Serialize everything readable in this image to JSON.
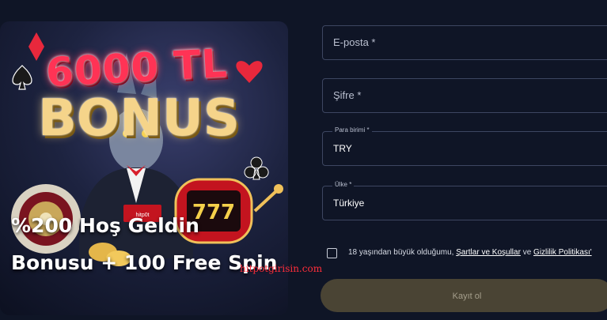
{
  "promo": {
    "amount": "6000 TL",
    "word": "BONUS",
    "headline_line1": "%200 Hoş Geldin",
    "headline_line2": "Bonusu + 100 Free Spin",
    "machine_label": "hitp0t"
  },
  "form": {
    "email_placeholder": "E-posta *",
    "password_placeholder": "Şifre *",
    "currency_label": "Para birimi *",
    "currency_value": "TRY",
    "country_label": "Ülke *",
    "country_value": "Türkiye",
    "consent_prefix": "18 yaşından büyük olduğumu, ",
    "terms_link": "Şartlar ve Koşullar",
    "consent_mid": " ve ",
    "privacy_link": "Gizlilik Politikası'",
    "consent_checked": false,
    "submit_label": "Kayıt ol"
  },
  "watermark": "hitpotgirisin.com",
  "colors": {
    "background": "#0f1526",
    "field_border": "#3d4661",
    "submit_bg": "#4a4434",
    "watermark": "#ff2d3a"
  }
}
